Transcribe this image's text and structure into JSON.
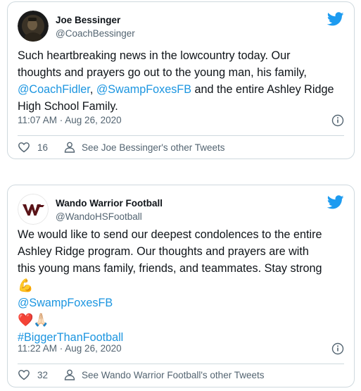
{
  "colors": {
    "link": "#1b95e0",
    "muted": "#536471",
    "border": "#cfd9de",
    "twitter_blue": "#1d9bf0"
  },
  "tweets": [
    {
      "name": "Joe Bessinger",
      "handle": "@CoachBessinger",
      "text_line1": "Such heartbreaking news in the lowcountry today. Our",
      "text_line2": "thoughts and prayers go out to the young man, his family,",
      "mention1": "@CoachFidler",
      "sep": ", ",
      "mention2": "@SwampFoxesFB",
      "text_line3_tail": " and the entire Ashley Ridge",
      "text_line4": "High School Family.",
      "timestamp": "11:07 AM · Aug 26, 2020",
      "likes": "16",
      "see_other": "See Joe Bessinger's other Tweets"
    },
    {
      "name": "Wando Warrior Football",
      "handle": "@WandoHSFootball",
      "text_line1": "We would like to send our deepest condolences to the entire",
      "text_line2": "Ashley Ridge program. Our thoughts and prayers are with",
      "text_line3": "this young mans family, friends, and teammates. Stay strong",
      "emoji_flex": "💪",
      "mention1": "@SwampFoxesFB",
      "emoji_heart": "❤️",
      "emoji_pray": "🙏🏻",
      "hashtag": "#BiggerThanFootball",
      "timestamp": "11:22 AM · Aug 26, 2020",
      "likes": "32",
      "see_other": "See Wando Warrior Football's other Tweets"
    }
  ]
}
